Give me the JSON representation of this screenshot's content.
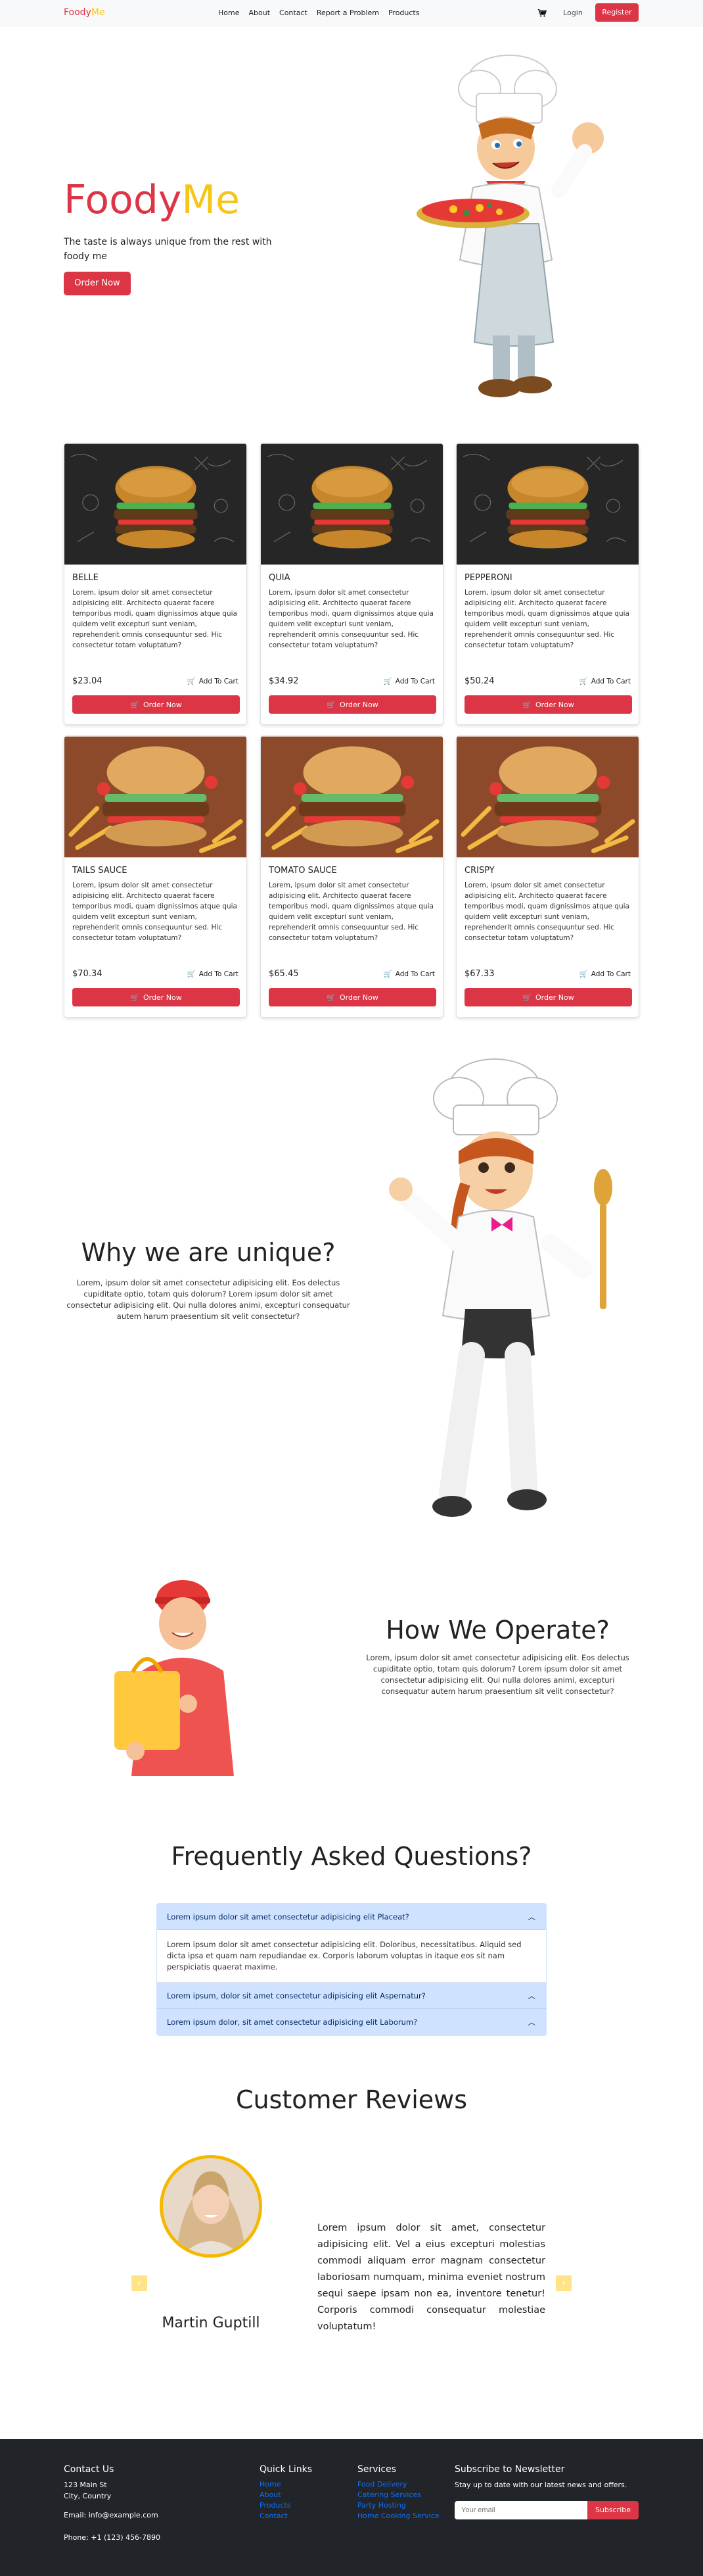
{
  "nav": {
    "brand_part1": "Foody",
    "brand_part2": "Me",
    "links": [
      "Home",
      "About",
      "Contact",
      "Report a Problem",
      "Products"
    ],
    "login": "Login",
    "register": "Register"
  },
  "hero": {
    "title_part1": "Foody",
    "title_part2": "Me",
    "tagline": "The taste is always unique from the rest with foody me",
    "button": "Order Now"
  },
  "products": [
    {
      "name": "BELLE",
      "price": "$23.04",
      "image": "burger-chalkboard",
      "desc": "Lorem, ipsum dolor sit amet consectetur adipisicing elit. Architecto quaerat facere temporibus modi, quam dignissimos atque quia quidem velit excepturi sunt veniam, reprehenderit omnis consequuntur sed. Hic consectetur totam voluptatum?"
    },
    {
      "name": "QUIA",
      "price": "$34.92",
      "image": "burger-chalkboard",
      "desc": "Lorem, ipsum dolor sit amet consectetur adipisicing elit. Architecto quaerat facere temporibus modi, quam dignissimos atque quia quidem velit excepturi sunt veniam, reprehenderit omnis consequuntur sed. Hic consectetur totam voluptatum?"
    },
    {
      "name": "PEPPERONI",
      "price": "$50.24",
      "image": "burger-chalkboard",
      "desc": "Lorem, ipsum dolor sit amet consectetur adipisicing elit. Architecto quaerat facere temporibus modi, quam dignissimos atque quia quidem velit excepturi sunt veniam, reprehenderit omnis consequuntur sed. Hic consectetur totam voluptatum?"
    },
    {
      "name": "TAILS SAUCE",
      "price": "$70.34",
      "image": "burger-fries",
      "desc": "Lorem, ipsum dolor sit amet consectetur adipisicing elit. Architecto quaerat facere temporibus modi, quam dignissimos atque quia quidem velit excepturi sunt veniam, reprehenderit omnis consequuntur sed. Hic consectetur totam voluptatum?"
    },
    {
      "name": "TOMATO SAUCE",
      "price": "$65.45",
      "image": "burger-fries",
      "desc": "Lorem, ipsum dolor sit amet consectetur adipisicing elit. Architecto quaerat facere temporibus modi, quam dignissimos atque quia quidem velit excepturi sunt veniam, reprehenderit omnis consequuntur sed. Hic consectetur totam voluptatum?"
    },
    {
      "name": "CRISPY",
      "price": "$67.33",
      "image": "burger-fries",
      "desc": "Lorem, ipsum dolor sit amet consectetur adipisicing elit. Architecto quaerat facere temporibus modi, quam dignissimos atque quia quidem velit excepturi sunt veniam, reprehenderit omnis consequuntur sed. Hic consectetur totam voluptatum?"
    }
  ],
  "card_labels": {
    "add_to_cart": "Add To Cart",
    "order_now": "Order Now"
  },
  "unique": {
    "title": "Why we are unique?",
    "text": "Lorem, ipsum dolor sit amet consectetur adipisicing elit. Eos delectus cupiditate optio, totam quis dolorum? Lorem ipsum dolor sit amet consectetur adipisicing elit. Qui nulla dolores animi, excepturi consequatur autem harum praesentium sit velit consectetur?"
  },
  "operate": {
    "title": "How We Operate?",
    "text": "Lorem, ipsum dolor sit amet consectetur adipisicing elit. Eos delectus cupiditate optio, totam quis dolorum? Lorem ipsum dolor sit amet consectetur adipisicing elit. Qui nulla dolores animi, excepturi consequatur autem harum praesentium sit velit consectetur?"
  },
  "faq": {
    "title": "Frequently Asked Questions?",
    "items": [
      {
        "q": "Lorem ipsum dolor sit amet consectetur adipisicing elit Placeat?",
        "a": "Lorem ipsum dolor sit amet consectetur adipisicing elit. Doloribus, necessitatibus. Aliquid sed dicta ipsa et quam nam repudiandae ex. Corporis laborum voluptas in itaque eos sit nam perspiciatis quaerat maxime.",
        "open": true
      },
      {
        "q": "Lorem ipsum, dolor sit amet consectetur adipisicing elit Aspernatur?",
        "open": false
      },
      {
        "q": "Lorem ipsum dolor, sit amet consectetur adipisicing elit Laborum?",
        "open": false
      }
    ]
  },
  "reviews": {
    "title": "Customer Reviews",
    "name": "Martin Guptill",
    "text": "Lorem ipsum dolor sit amet, consectetur adipisicing elit. Vel a eius excepturi molestias commodi aliquam error magnam consectetur laboriosam numquam, minima eveniet nostrum sequi saepe ipsam non ea, inventore tenetur! Corporis commodi consequatur molestiae voluptatum!"
  },
  "footer": {
    "contact": {
      "title": "Contact Us",
      "address1": "123 Main St",
      "address2": "City, Country",
      "email": "Email: info@example.com",
      "phone": "Phone: +1 (123) 456-7890"
    },
    "quick_links": {
      "title": "Quick Links",
      "links": [
        "Home",
        "About",
        "Products",
        "Contact"
      ]
    },
    "services": {
      "title": "Services",
      "links": [
        "Food Delivery",
        "Catering Services",
        "Party Hosting",
        "Home Cooking Service"
      ]
    },
    "newsletter": {
      "title": "Subscribe to Newsletter",
      "text": "Stay up to date with our latest news and offers.",
      "placeholder": "Your email",
      "button": "Subscribe"
    }
  },
  "colors": {
    "primary": "#dc3545",
    "accent": "#f5c518",
    "footer_bg": "#212529",
    "faq_bg": "#cfe2ff"
  },
  "icons": [
    "cart-icon",
    "chevron-up-icon",
    "chevron-left-icon",
    "chevron-right-icon"
  ]
}
